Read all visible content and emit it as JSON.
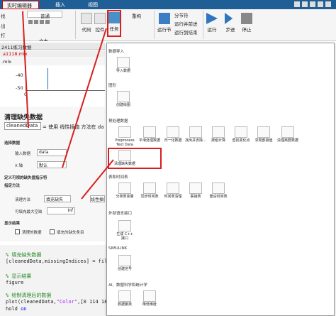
{
  "tabs": [
    {
      "label": "实时编辑器",
      "active": true
    },
    {
      "label": "插入"
    },
    {
      "label": "视图"
    }
  ],
  "toolbar": {
    "normal": "普通",
    "text_group": "文本",
    "left_cut": [
      "找",
      "出",
      "打"
    ],
    "code": "代码",
    "controls": "控件",
    "task": "任务",
    "refactor": "重构",
    "section_break": "分节符",
    "run_section": "运行节",
    "run_advance": "运行并前进",
    "run_to_end": "运行到结束",
    "run": "运行",
    "step": "步进",
    "stop": "停止"
  },
  "file_tabs": {
    "a": "2411练习数据",
    "b": "a1118.mlx",
    "c": ".mlx"
  },
  "plot_axis": {
    "ticks": [
      "-40",
      "-50"
    ],
    "label_0": "0"
  },
  "task": {
    "title": "清理缺失数据",
    "var": "cleanedData",
    "desc_eq": "= 使用 线性插值 方法在 da",
    "s1": "选择数据",
    "input_label": "输入数据",
    "input_val": "data",
    "x_label": "X 轴",
    "x_val": "默认",
    "s2": "定义可视的缺失值指示符",
    "s3": "指定方法",
    "cleanup_label": "清理方法",
    "cleanup_val": "填充缺失",
    "cleanup_val2": "线性插值",
    "gap_label": "可填充最大空缺",
    "gap_val": "Inf",
    "s4": "显示结果",
    "chk1": "清理的数据",
    "chk2": "填充的缺失条目"
  },
  "code": {
    "l1": "% 填充缺失数据",
    "l2a": "[cleanedData,missingIndices] = fill",
    "l3": "% 显示结果",
    "l4": "figure",
    "l5": "% 绘制清理后的数据",
    "l6a": "plot(cleanedData,",
    "l6b": "\"Color\"",
    "l6c": ",[0 114 189",
    "l7a": "hold",
    "l7b": "on"
  },
  "gallery": {
    "sec_import": "数据导入",
    "import_data": "导入数据",
    "sec_graph": "图形",
    "create_plot": "创建绘图",
    "sec_pre": "预处理数据",
    "pre_items": [
      "Preprocess Text Data",
      "平滑处理数据",
      "归一化数据",
      "找出并去除...",
      "按组计算",
      "查找变化点",
      "求局部极值",
      "清理离群数据"
    ],
    "clean_missing": "清理缺失数据",
    "sec_tbl": "表和时间表",
    "tbl_items": [
      "分类表变量",
      "同步时间表",
      "时间表清理",
      "联接表",
      "重设时间表"
    ],
    "sec_ext": "外部语言接口",
    "c_iface": "生成 C++ 接口",
    "sec_sim": "SIMULINK",
    "create_signal": "创建信号",
    "sec_ai": "AI、数据科学和统计学",
    "ai_items": [
      "数据聚类",
      "降低维度"
    ]
  }
}
